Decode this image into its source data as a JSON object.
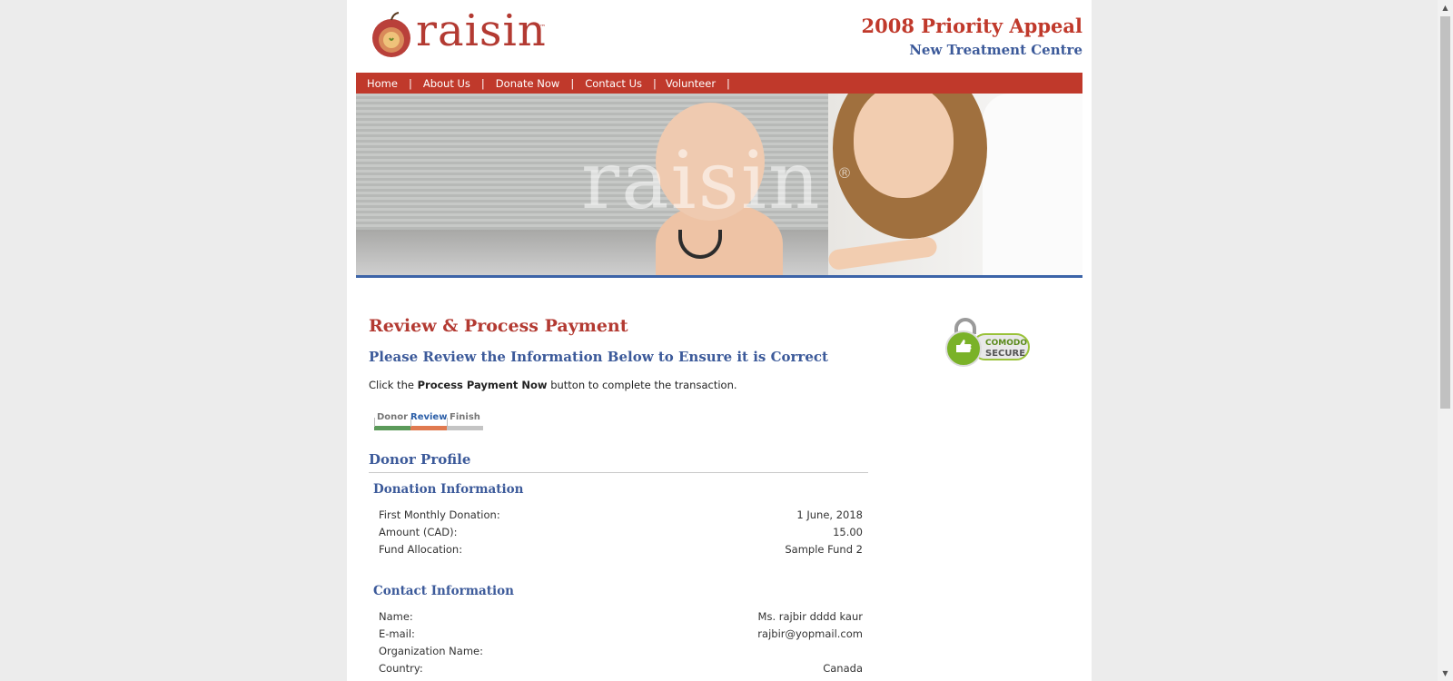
{
  "header": {
    "logo_text": "raisin",
    "logo_tm": "™",
    "appeal_title": "2008 Priority Appeal",
    "appeal_subtitle": "New Treatment Centre"
  },
  "nav": {
    "items": [
      {
        "label": "Home"
      },
      {
        "label": "About Us"
      },
      {
        "label": "Donate Now"
      },
      {
        "label": "Contact Us"
      },
      {
        "label": "Volunteer"
      }
    ],
    "separator": "|"
  },
  "hero": {
    "watermark": "raisin",
    "watermark_mark": "®"
  },
  "main": {
    "title": "Review & Process Payment",
    "subtitle": "Please Review the Information Below to Ensure it is Correct",
    "intro_before": "Click the ",
    "intro_bold": "Process Payment Now",
    "intro_after": " button to complete the transaction.",
    "badge": {
      "line1": "COMODO",
      "line2": "SECURE"
    },
    "steps": [
      {
        "label": "Donor",
        "state": "done",
        "color": "#5b9a5a"
      },
      {
        "label": "Review",
        "state": "current",
        "color": "#e07a50"
      },
      {
        "label": "Finish",
        "state": "pending",
        "color": "#c4c4c4"
      }
    ],
    "profile_title": "Donor Profile",
    "donation": {
      "title": "Donation Information",
      "rows": [
        {
          "label": "First Monthly Donation:",
          "value": "1 June, 2018"
        },
        {
          "label": "Amount (CAD):",
          "value": "15.00"
        },
        {
          "label": "Fund Allocation:",
          "value": "Sample Fund 2"
        }
      ]
    },
    "contact": {
      "title": "Contact Information",
      "rows": [
        {
          "label": "Name:",
          "value": "Ms. rajbir dddd kaur"
        },
        {
          "label": "E-mail:",
          "value": "rajbir@yopmail.com"
        },
        {
          "label": "Organization Name:",
          "value": ""
        },
        {
          "label": "Country:",
          "value": "Canada"
        }
      ]
    }
  },
  "colors": {
    "brand_red": "#c0392b",
    "brand_blue": "#3c5a9a"
  }
}
